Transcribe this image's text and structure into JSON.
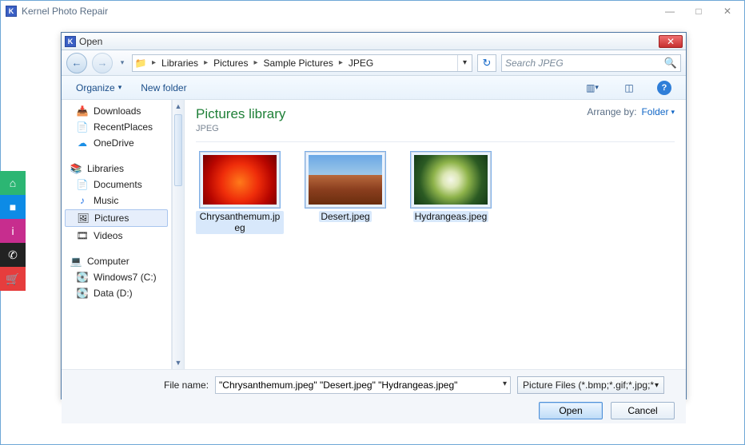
{
  "app": {
    "title": "Kernel Photo Repair",
    "logo_letter": "K"
  },
  "dock": [
    {
      "name": "home-icon",
      "glyph": "⌂",
      "cls": "green"
    },
    {
      "name": "camera-icon",
      "glyph": "■",
      "cls": "blue"
    },
    {
      "name": "info-icon",
      "glyph": "i",
      "cls": "magenta"
    },
    {
      "name": "phone-icon",
      "glyph": "✆",
      "cls": "black"
    },
    {
      "name": "cart-icon",
      "glyph": "🛒",
      "cls": "red"
    }
  ],
  "dialog": {
    "title": "Open",
    "close_glyph": "✕",
    "back_glyph": "←",
    "fwd_glyph": "→",
    "refresh_glyph": "↻",
    "breadcrumb": [
      "Libraries",
      "Pictures",
      "Sample Pictures",
      "JPEG"
    ],
    "search_placeholder": "Search JPEG",
    "toolbar": {
      "organize": "Organize",
      "newfolder": "New folder"
    },
    "tree": {
      "items": [
        {
          "type": "item",
          "icon": "📥",
          "label": "Downloads"
        },
        {
          "type": "item",
          "icon": "📄",
          "label": "RecentPlaces"
        },
        {
          "type": "item",
          "icon": "☁",
          "label": "OneDrive",
          "iconColor": "#1b8fe6"
        },
        {
          "type": "gap"
        },
        {
          "type": "group",
          "icon": "📚",
          "label": "Libraries"
        },
        {
          "type": "item",
          "icon": "📄",
          "label": "Documents"
        },
        {
          "type": "item",
          "icon": "♪",
          "label": "Music",
          "iconColor": "#1b6fe6"
        },
        {
          "type": "item",
          "icon": "🖼",
          "label": "Pictures",
          "selected": true
        },
        {
          "type": "item",
          "icon": "🎞",
          "label": "Videos"
        },
        {
          "type": "gap"
        },
        {
          "type": "group",
          "icon": "💻",
          "label": "Computer"
        },
        {
          "type": "item",
          "icon": "💽",
          "label": "Windows7 (C:)"
        },
        {
          "type": "item",
          "icon": "💽",
          "label": "Data (D:)"
        }
      ]
    },
    "content": {
      "heading": "Pictures library",
      "subheading": "JPEG",
      "arrange_label": "Arrange by:",
      "arrange_value": "Folder",
      "files": [
        {
          "label": "Chrysanthemum.jpeg",
          "cls": "flower",
          "selected": true
        },
        {
          "label": "Desert.jpeg",
          "cls": "desert",
          "selected": true
        },
        {
          "label": "Hydrangeas.jpeg",
          "cls": "hydra",
          "selected": true
        }
      ]
    },
    "footer": {
      "filename_label": "File name:",
      "filename_value": "\"Chrysanthemum.jpeg\" \"Desert.jpeg\" \"Hydrangeas.jpeg\"",
      "filter_label": "Picture Files (*.bmp;*.gif;*.jpg;*",
      "open_label": "Open",
      "cancel_label": "Cancel"
    }
  }
}
